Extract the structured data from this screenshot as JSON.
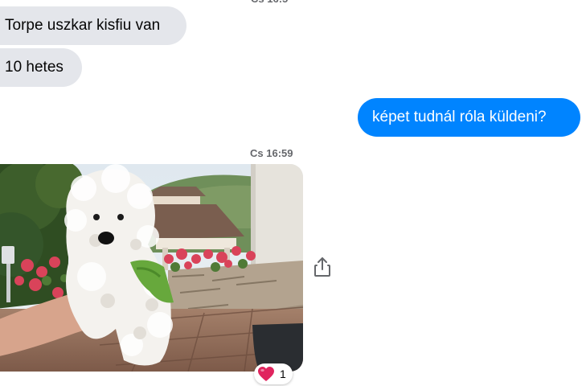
{
  "messages": {
    "incoming_1": "Torpe uszkar kisfiu van",
    "incoming_2": "10 hetes",
    "outgoing_1": "képet tudnál róla küldeni?"
  },
  "timestamp": "Cs 16:59",
  "photo": {
    "icon": "photo-of-white-poodle-puppy"
  },
  "share": {
    "icon": "share-icon"
  },
  "reaction": {
    "emoji": "heart",
    "count": "1"
  },
  "colors": {
    "incoming_bubble": "#e4e6eb",
    "outgoing_bubble": "#0084ff",
    "heart": "#e0245e"
  }
}
